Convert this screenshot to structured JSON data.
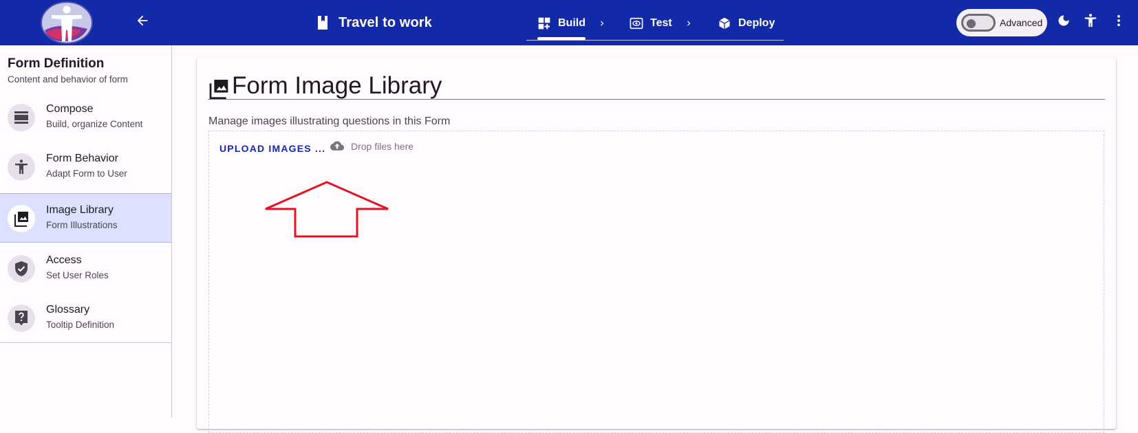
{
  "colors": {
    "brand": "#1229a8",
    "active_nav": "#dde1ff",
    "annotation": "#e3141f"
  },
  "topbar": {
    "form_title": "Travel to work",
    "form_icon": "book-icon",
    "steps": [
      {
        "label": "Build",
        "icon": "build-grid-icon",
        "active": true
      },
      {
        "label": "Test",
        "icon": "eye-icon",
        "active": false
      },
      {
        "label": "Deploy",
        "icon": "package-icon",
        "active": false
      }
    ],
    "advanced_label": "Advanced",
    "advanced_on": false,
    "icons": [
      "arrow-back-icon",
      "dark-mode-icon",
      "accessibility-icon",
      "more-vert-icon"
    ]
  },
  "sidebar": {
    "title": "Form Definition",
    "subtitle": "Content and behavior of form",
    "items": [
      {
        "label": "Compose",
        "sub": "Build, organize Content",
        "icon": "compose-icon",
        "active": false
      },
      {
        "label": "Form Behavior",
        "sub": "Adapt Form to User",
        "icon": "accessibility-icon",
        "active": false
      },
      {
        "label": "Image Library",
        "sub": "Form Illustrations",
        "icon": "photo-library-icon",
        "active": true
      },
      {
        "label": "Access",
        "sub": "Set User Roles",
        "icon": "shield-check-icon",
        "active": false
      },
      {
        "label": "Glossary",
        "sub": "Tooltip Definition",
        "icon": "help-bubble-icon",
        "active": false
      }
    ]
  },
  "main": {
    "title": "Form Image Library",
    "description": "Manage images illustrating questions in this Form",
    "upload_label": "UPLOAD IMAGES ...",
    "drop_hint": "Drop files here"
  }
}
